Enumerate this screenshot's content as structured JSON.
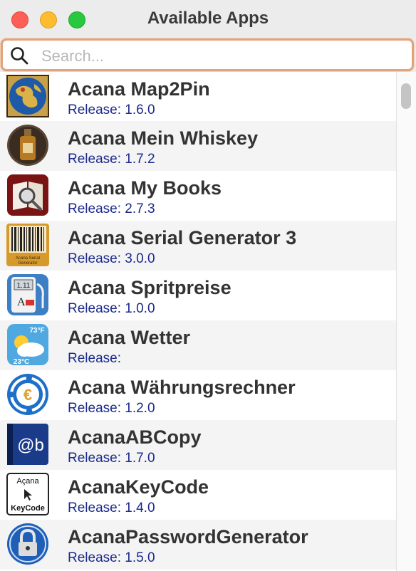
{
  "window": {
    "title": "Available Apps"
  },
  "search": {
    "placeholder": "Search..."
  },
  "apps": [
    {
      "name": "Acana Map2Pin",
      "release": "Release: 1.6.0",
      "icon": "globe-map-icon"
    },
    {
      "name": "Acana Mein Whiskey",
      "release": "Release: 1.7.2",
      "icon": "whiskey-bottle-icon"
    },
    {
      "name": "Acana My Books",
      "release": "Release: 2.7.3",
      "icon": "book-magnifier-icon"
    },
    {
      "name": "Acana Serial Generator 3",
      "release": "Release: 3.0.0",
      "icon": "barcode-icon",
      "icon_text": "Acana Serial Generator"
    },
    {
      "name": "Acana Spritpreise",
      "release": "Release: 1.0.0",
      "icon": "fuel-pump-icon",
      "icon_text": "1.11"
    },
    {
      "name": "Acana Wetter",
      "release": "Release:",
      "icon": "weather-icon",
      "icon_text": [
        "73°F",
        "23°C"
      ]
    },
    {
      "name": "Acana Währungsrechner",
      "release": "Release: 1.2.0",
      "icon": "euro-currency-icon"
    },
    {
      "name": "AcanaABCopy",
      "release": "Release: 1.7.0",
      "icon": "at-b-icon",
      "icon_text": "@b"
    },
    {
      "name": "AcanaKeyCode",
      "release": "Release: 1.4.0",
      "icon": "keycode-icon",
      "icon_text": [
        "Açana",
        "KeyCode"
      ]
    },
    {
      "name": "AcanaPasswordGenerator",
      "release": "Release: 1.5.0",
      "icon": "padlock-icon"
    }
  ],
  "colors": {
    "release_text": "#1b2a8c",
    "search_focus_ring": "#e0a47d",
    "row_alt": "#f4f4f5"
  }
}
